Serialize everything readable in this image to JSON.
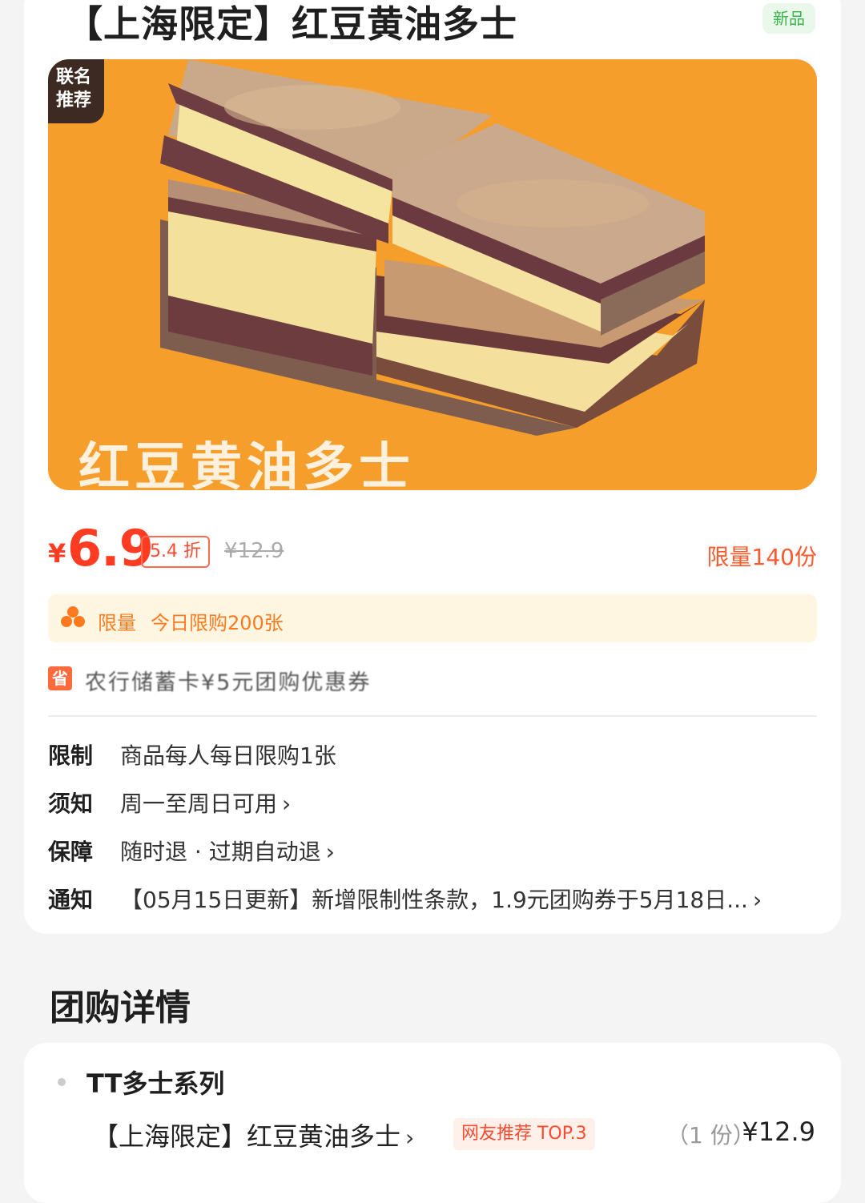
{
  "header": {
    "title": "【上海限定】红豆黄油多士",
    "badge": "新品"
  },
  "hero": {
    "corner_tag_line1": "联名",
    "corner_tag_line2": "推荐",
    "caption": "红豆黄油多士",
    "bg_color": "#f59e2b"
  },
  "price": {
    "currency": "¥",
    "current": "6.9",
    "discount": "5.4 折",
    "original": "¥12.9",
    "limit_qty": "限量140份",
    "accent_color": "#ff3b22"
  },
  "promo": {
    "label": "限量",
    "text": "今日限购200张"
  },
  "save": {
    "icon": "省",
    "text": "农行储蓄卡¥5元团购优惠券"
  },
  "info": {
    "rows": [
      {
        "key": "限制",
        "value": "商品每人每日限购1张",
        "chevron": ""
      },
      {
        "key": "须知",
        "value": "周一至周日可用",
        "chevron": "›"
      },
      {
        "key": "保障",
        "value": "随时退 · 过期自动退",
        "chevron": "›"
      },
      {
        "key": "通知",
        "value": "【05月15日更新】新增限制性条款，1.9元团购券于5月18日...",
        "chevron": "›"
      }
    ]
  },
  "details": {
    "title": "团购详情",
    "series": "TT多士系列",
    "item_name": "【上海限定】红豆黄油多士",
    "item_chevron": "›",
    "item_tag": "网友推荐 TOP.3",
    "item_qty": "（1 份）",
    "item_price": "¥12.9"
  }
}
